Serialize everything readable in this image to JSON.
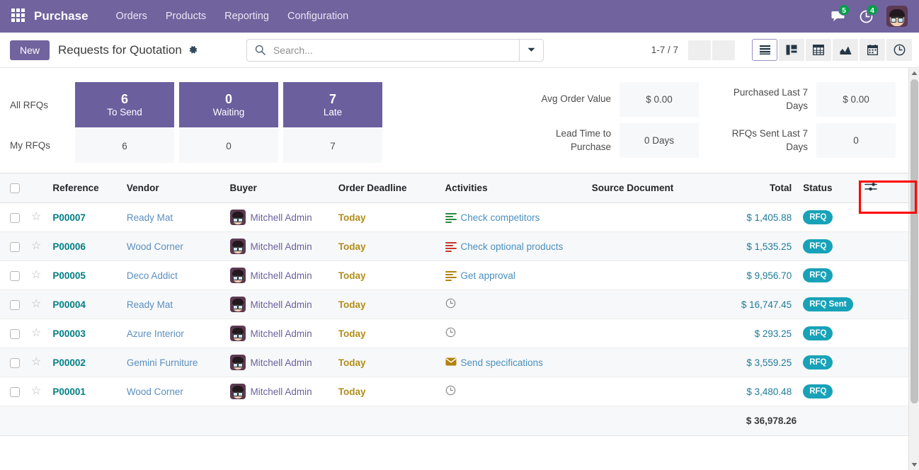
{
  "navbar": {
    "apps_icon": "apps-grid-icon",
    "brand": "Purchase",
    "menus": [
      {
        "label": "Orders"
      },
      {
        "label": "Products"
      },
      {
        "label": "Reporting"
      },
      {
        "label": "Configuration"
      }
    ],
    "messages_icon": "chat-bubble-icon",
    "messages_count": "5",
    "activities_icon": "clock-activity-icon",
    "activities_count": "4",
    "avatar_icon": "user-avatar"
  },
  "control_panel": {
    "new_label": "New",
    "title": "Requests for Quotation",
    "gear_icon": "gear-icon",
    "search_icon": "search-icon",
    "search_value": "",
    "search_placeholder": "Search...",
    "search_toggle_icon": "chevron-down-icon",
    "pager": "1-7 / 7",
    "pager_prev_icon": "chevron-left-icon",
    "pager_next_icon": "chevron-right-icon",
    "views": [
      {
        "name": "list",
        "icon": "list-view-icon",
        "active": true
      },
      {
        "name": "kanban",
        "icon": "kanban-view-icon",
        "active": false
      },
      {
        "name": "pivot",
        "icon": "pivot-view-icon",
        "active": false
      },
      {
        "name": "graph",
        "icon": "graph-view-icon",
        "active": false
      },
      {
        "name": "calendar",
        "icon": "calendar-view-icon",
        "active": false
      },
      {
        "name": "activity",
        "icon": "activity-view-icon",
        "active": false
      }
    ]
  },
  "dashboard": {
    "row_labels": {
      "all": "All RFQs",
      "my": "My RFQs"
    },
    "tiles": [
      {
        "value": "6",
        "label": "To Send",
        "my_value": "6"
      },
      {
        "value": "0",
        "label": "Waiting",
        "my_value": "0"
      },
      {
        "value": "7",
        "label": "Late",
        "my_value": "7"
      }
    ],
    "metrics": [
      {
        "name": "Avg Order Value",
        "value": "$ 0.00"
      },
      {
        "name": "Lead Time to Purchase",
        "value": "0 Days"
      },
      {
        "name": "Purchased Last 7 Days",
        "value": "$ 0.00"
      },
      {
        "name": "RFQs Sent Last 7 Days",
        "value": "0"
      }
    ]
  },
  "table": {
    "select_all_icon": "checkbox",
    "headers": {
      "reference": "Reference",
      "vendor": "Vendor",
      "buyer": "Buyer",
      "deadline": "Order Deadline",
      "activities": "Activities",
      "source": "Source Document",
      "total": "Total",
      "status": "Status",
      "optional": "optional-columns-toggle-icon"
    },
    "rows": [
      {
        "reference": "P00007",
        "vendor": "Ready Mat",
        "buyer": "Mitchell Admin",
        "deadline": "Today",
        "activity": "Check competitors",
        "activity_icon": "activity-todo-green-icon",
        "source": "",
        "total": "$ 1,405.88",
        "status": "RFQ"
      },
      {
        "reference": "P00006",
        "vendor": "Wood Corner",
        "buyer": "Mitchell Admin",
        "deadline": "Today",
        "activity": "Check optional products",
        "activity_icon": "activity-late-red-icon",
        "source": "",
        "total": "$ 1,535.25",
        "status": "RFQ"
      },
      {
        "reference": "P00005",
        "vendor": "Deco Addict",
        "buyer": "Mitchell Admin",
        "deadline": "Today",
        "activity": "Get approval",
        "activity_icon": "activity-today-amber-icon",
        "source": "",
        "total": "$ 9,956.70",
        "status": "RFQ"
      },
      {
        "reference": "P00004",
        "vendor": "Ready Mat",
        "buyer": "Mitchell Admin",
        "deadline": "Today",
        "activity": "",
        "activity_icon": "clock-icon",
        "source": "",
        "total": "$ 16,747.45",
        "status": "RFQ Sent"
      },
      {
        "reference": "P00003",
        "vendor": "Azure Interior",
        "buyer": "Mitchell Admin",
        "deadline": "Today",
        "activity": "",
        "activity_icon": "clock-icon",
        "source": "",
        "total": "$ 293.25",
        "status": "RFQ"
      },
      {
        "reference": "P00002",
        "vendor": "Gemini Furniture",
        "buyer": "Mitchell Admin",
        "deadline": "Today",
        "activity": "Send specifications",
        "activity_icon": "email-amber-icon",
        "source": "",
        "total": "$ 3,559.25",
        "status": "RFQ"
      },
      {
        "reference": "P00001",
        "vendor": "Wood Corner",
        "buyer": "Mitchell Admin",
        "deadline": "Today",
        "activity": "",
        "activity_icon": "clock-icon",
        "source": "",
        "total": "$ 3,480.48",
        "status": "RFQ"
      }
    ],
    "footer_total": "$ 36,978.26"
  },
  "colors": {
    "navbar_purple": "#71639e",
    "tile_purple": "#6b5f9e",
    "badge_teal": "#17a2b8",
    "count_green": "#00a04a",
    "deadline_amber": "#b08d18",
    "highlight_red": "#ff0000"
  }
}
